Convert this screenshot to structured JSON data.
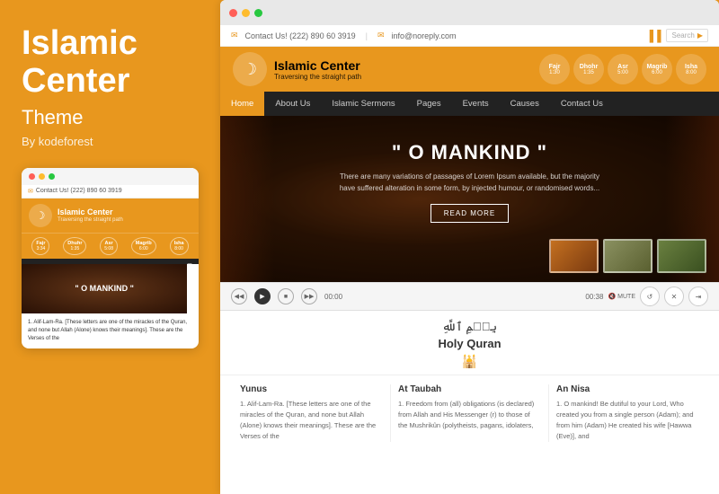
{
  "left": {
    "title": "Islamic\nCenter",
    "subtitle": "Theme",
    "by": "By kodeforest"
  },
  "mobile": {
    "dots": [
      "red",
      "yellow",
      "green"
    ],
    "contact": "Contact Us! (222) 890 60 3919",
    "site_name": "Islamic Center",
    "tagline": "Traversing the straight path",
    "prayer_times": [
      {
        "name": "Fajr",
        "time": "3:34"
      },
      {
        "name": "Dhuhr",
        "time": "1:35"
      },
      {
        "name": "Asr",
        "time": "5:08"
      },
      {
        "name": "Magrib",
        "time": "6:00"
      },
      {
        "name": "Isha",
        "time": "8:00"
      }
    ],
    "hero_text": "\" O MANKIND \"",
    "body_text": "1. Alif-Lam-Ra. [These letters are one of the miracles of the Quran, and none but Allah (Alone) knows their meanings]. These are the Verses of the"
  },
  "browser": {
    "top_bar": {
      "contact": "Contact Us! (222) 890 60 3919",
      "email": "info@noreply.com",
      "search_placeholder": "Search"
    },
    "header": {
      "site_name": "Islamic Center",
      "tagline": "Traversing the straight path",
      "prayer_times": [
        {
          "name": "Fajr",
          "time": "1:30"
        },
        {
          "name": "Dhuhr",
          "time": "1:35"
        },
        {
          "name": "Asr",
          "time": "5:00"
        },
        {
          "name": "Magrib",
          "time": "6:00"
        },
        {
          "name": "Isha",
          "time": "8:00"
        }
      ]
    },
    "nav": {
      "items": [
        "Home",
        "About Us",
        "Islamic Sermons",
        "Pages",
        "Events",
        "Causes",
        "Contact Us"
      ],
      "active": "Home"
    },
    "hero": {
      "title": "\" O MANKIND \"",
      "text": "There are many variations of passages of Lorem Ipsum available, but the majority have suffered alteration in some form, by injected humour, or randomised words...",
      "button": "READ MORE"
    },
    "player": {
      "time_start": "00:00",
      "time_end": "00:38",
      "mute_label": "MUTE"
    },
    "quran": {
      "arabic": "بِسۡمِ ٱللَّهِ",
      "title": "Holy Quran",
      "icon": "⚙"
    },
    "columns": [
      {
        "title": "Yunus",
        "text": "1. Alif-Lam-Ra. [These letters are one of the miracles of the Quran, and none but Allah (Alone) knows their meanings]. These are the Verses of the"
      },
      {
        "title": "At Taubah",
        "text": "1. Freedom from (all) obligations (is declared) from Allah and His Messenger (r) to those of the Mushrikûn (polytheists, pagans, idolaters,"
      },
      {
        "title": "An Nisa",
        "text": "1. O mankind! Be dutiful to your Lord, Who created you from a single person (Adam); and from him (Adam) He created his wife [Hawwa (Eve)], and"
      }
    ]
  }
}
